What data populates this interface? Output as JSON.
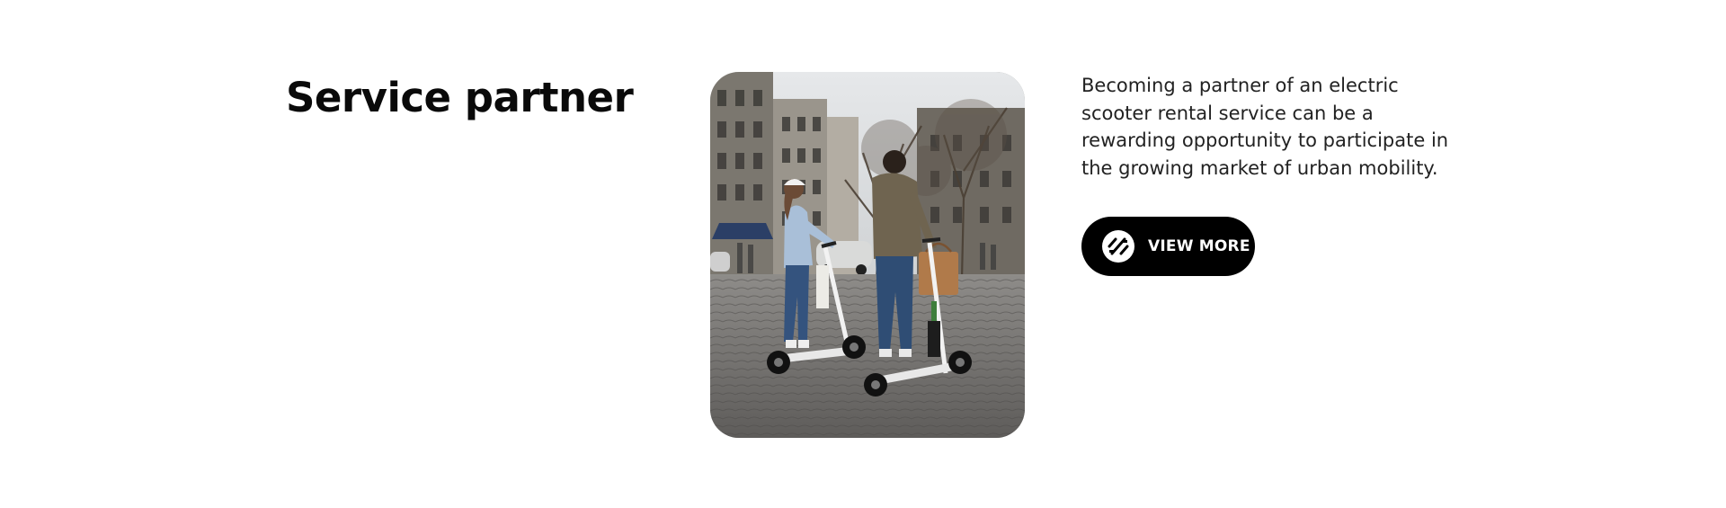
{
  "section": {
    "title": "Service partner",
    "description": "Becoming a partner of an electric scooter rental service can be a rewarding opportunity to participate in the growing market of urban mobility.",
    "cta": {
      "label": "VIEW MORE",
      "icon": "scooter-badge-icon"
    },
    "image": {
      "alt": "Two people riding electric scooters on a cobblestone city square"
    }
  },
  "colors": {
    "background": "#ffffff",
    "text": "#111111",
    "button_bg": "#000000",
    "button_text": "#ffffff"
  }
}
